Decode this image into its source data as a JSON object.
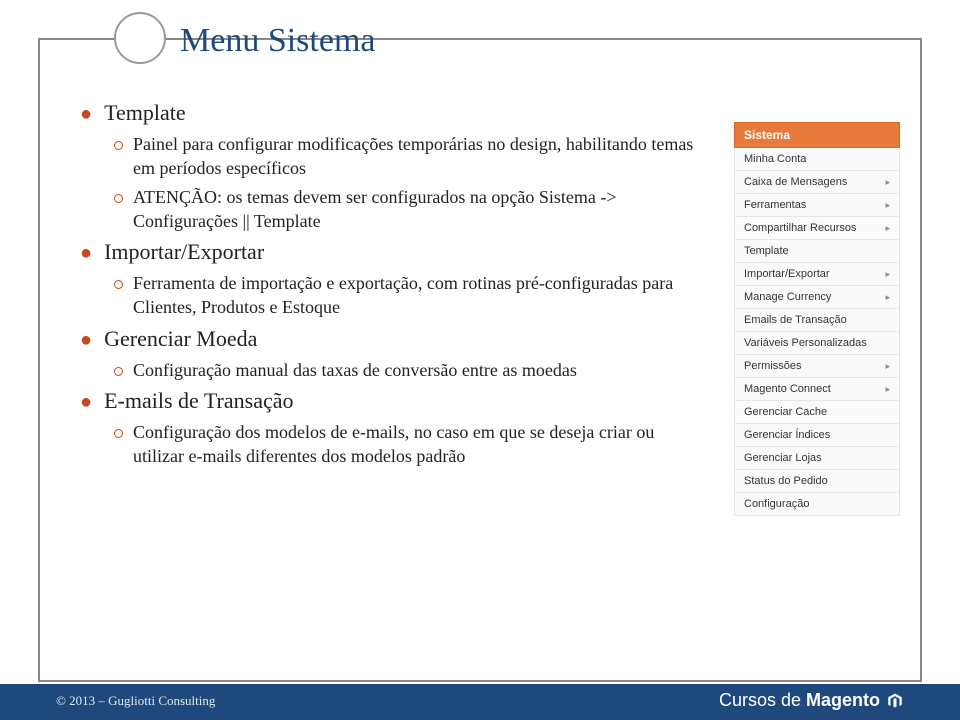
{
  "title": "Menu Sistema",
  "bullets": {
    "template": {
      "label": "Template",
      "subs": [
        "Painel para configurar modificações temporárias no design, habilitando temas em períodos específicos",
        "ATENÇÃO: os temas devem ser configurados na opção Sistema -> Configurações || Template"
      ]
    },
    "import": {
      "label": "Importar/Exportar",
      "subs": [
        "Ferramenta de importação e exportação, com rotinas pré-configuradas para Clientes, Produtos e Estoque"
      ]
    },
    "moeda": {
      "label": "Gerenciar Moeda",
      "subs": [
        "Configuração manual das taxas de conversão entre as moedas"
      ]
    },
    "emails": {
      "label": "E-mails de Transação",
      "subs": [
        "Configuração dos modelos de e-mails, no caso em que se deseja criar ou utilizar e-mails diferentes dos modelos padrão"
      ]
    }
  },
  "sidebar": {
    "header": "Sistema",
    "items": [
      {
        "label": "Minha Conta",
        "sub": false
      },
      {
        "label": "Caixa de Mensagens",
        "sub": true
      },
      {
        "label": "Ferramentas",
        "sub": true
      },
      {
        "label": "Compartilhar Recursos",
        "sub": true
      },
      {
        "label": "Template",
        "sub": false
      },
      {
        "label": "Importar/Exportar",
        "sub": true
      },
      {
        "label": "Manage Currency",
        "sub": true
      },
      {
        "label": "Emails de Transação",
        "sub": false
      },
      {
        "label": "Variáveis Personalizadas",
        "sub": false
      },
      {
        "label": "Permissões",
        "sub": true
      },
      {
        "label": "Magento Connect",
        "sub": true
      },
      {
        "label": "Gerenciar Cache",
        "sub": false
      },
      {
        "label": "Gerenciar Índices",
        "sub": false
      },
      {
        "label": "Gerenciar Lojas",
        "sub": false
      },
      {
        "label": "Status do Pedido",
        "sub": false
      },
      {
        "label": "Configuração",
        "sub": false
      }
    ]
  },
  "footer": {
    "left": "© 2013 – Gugliotti Consulting",
    "right_prefix": "Cursos de ",
    "right_brand": "Magento"
  }
}
